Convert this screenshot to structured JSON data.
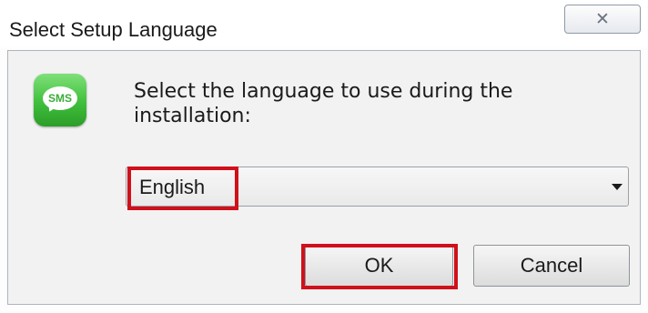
{
  "window": {
    "title": "Select Setup Language",
    "close_icon": "close-x-icon"
  },
  "icon": {
    "name": "sms-app-icon",
    "label": "SMS",
    "color": "#3fbf3b"
  },
  "prompt": {
    "text": "Select the language to use during the installation:"
  },
  "language_select": {
    "selected": "English",
    "arrow_icon": "chevron-down-icon"
  },
  "buttons": {
    "ok_label": "OK",
    "cancel_label": "Cancel"
  },
  "highlights": {
    "color": "#d0101a"
  }
}
